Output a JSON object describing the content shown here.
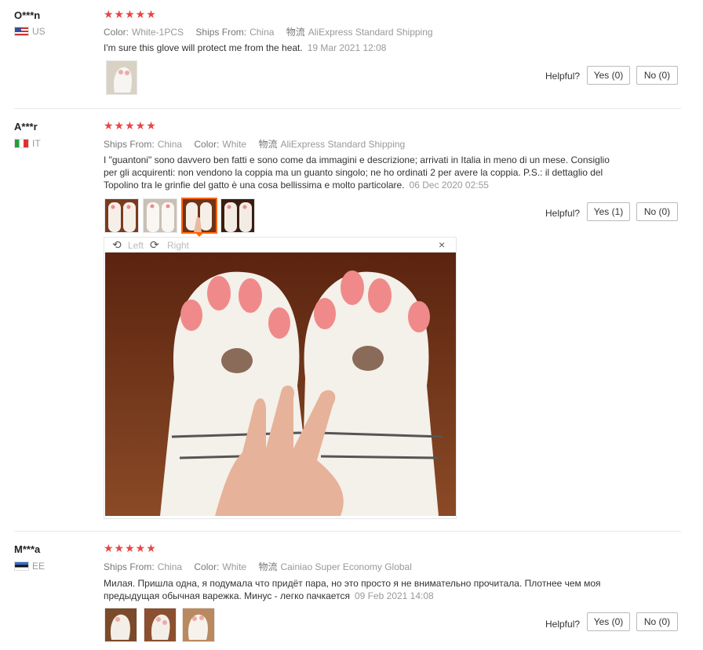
{
  "reviews": [
    {
      "user": "O***n",
      "country": "US",
      "stars": "★★★★★",
      "meta": [
        {
          "k": "Color:",
          "v": "White-1PCS"
        },
        {
          "k": "Ships From:",
          "v": "China"
        },
        {
          "k": "物流",
          "v": "AliExpress Standard Shipping"
        }
      ],
      "text": "I'm sure this glove will protect me from the heat.",
      "date": "19 Mar 2021 12:08",
      "helpful": "Helpful?",
      "yes": "Yes (0)",
      "no": "No (0)"
    },
    {
      "user": "A***r",
      "country": "IT",
      "stars": "★★★★★",
      "meta": [
        {
          "k": "Ships From:",
          "v": "China"
        },
        {
          "k": "Color:",
          "v": "White"
        },
        {
          "k": "物流",
          "v": "AliExpress Standard Shipping"
        }
      ],
      "text": "I \"guantoni\" sono davvero ben fatti e sono come da immagini e descrizione; arrivati in Italia in meno di un mese. Consiglio per gli acquirenti: non vendono la coppia ma un guanto singolo; ne ho ordinati 2 per avere la coppia. P.S.: il dettaglio del Topolino tra le grinfie del gatto è una cosa bellissima e molto particolare.",
      "date": "06 Dec 2020 02:55",
      "helpful": "Helpful?",
      "yes": "Yes (1)",
      "no": "No (0)",
      "viewer": {
        "left": "Left",
        "right": "Right",
        "close": "×"
      }
    },
    {
      "user": "M***a",
      "country": "EE",
      "stars": "★★★★★",
      "meta": [
        {
          "k": "Ships From:",
          "v": "China"
        },
        {
          "k": "Color:",
          "v": "White"
        },
        {
          "k": "物流",
          "v": "Cainiao Super Economy Global"
        }
      ],
      "text": "Милая. Пришла одна, я подумала что придёт пара, но это просто я не внимательно прочитала. Плотнее чем моя предыдущая обычная варежка. Минус - легко пачкается",
      "date": "09 Feb 2021 14:08",
      "helpful": "Helpful?",
      "yes": "Yes (0)",
      "no": "No (0)"
    }
  ],
  "colors": {
    "star": "#e84545",
    "selected_thumb": "#ff6600"
  }
}
